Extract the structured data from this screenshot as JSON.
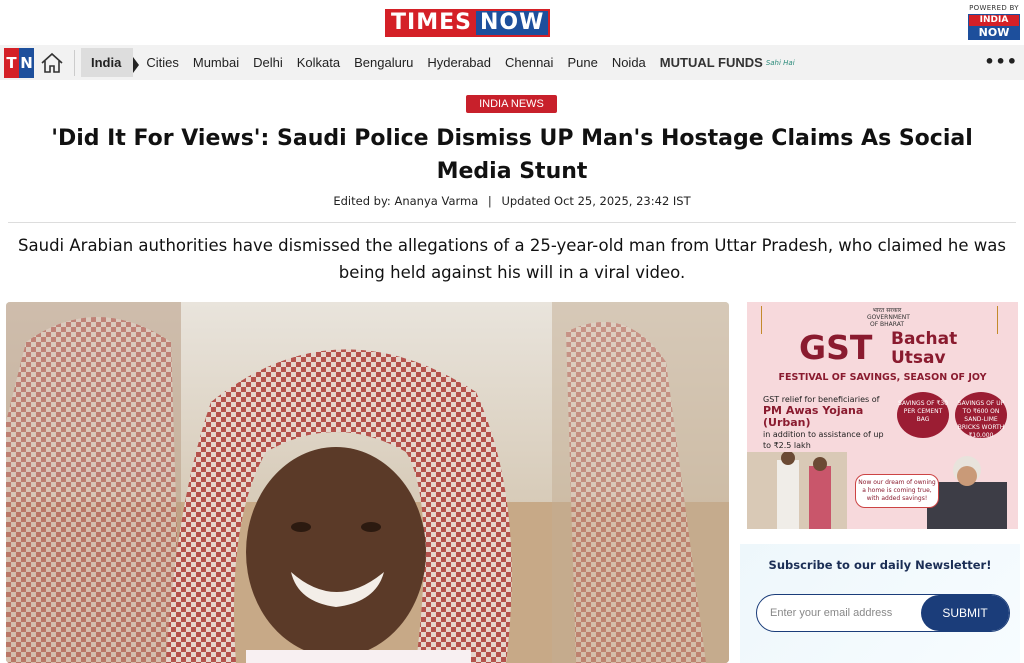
{
  "header": {
    "logo_left": "TIMES",
    "logo_right": "NOW",
    "powered_by": "POWERED BY",
    "partner_top": "INDIA",
    "partner_bottom": "NOW"
  },
  "nav": {
    "brand_t": "T",
    "brand_n": "N",
    "items": [
      {
        "label": "India",
        "active": true
      },
      {
        "label": "Cities"
      },
      {
        "label": "Mumbai"
      },
      {
        "label": "Delhi"
      },
      {
        "label": "Kolkata"
      },
      {
        "label": "Bengaluru"
      },
      {
        "label": "Hyderabad"
      },
      {
        "label": "Chennai"
      },
      {
        "label": "Pune"
      },
      {
        "label": "Noida"
      },
      {
        "label": "MUTUAL FUNDS"
      }
    ],
    "mf_tag": "Sahi Hai",
    "more": "•••"
  },
  "article": {
    "category": "INDIA NEWS",
    "headline": "'Did It For Views': Saudi Police Dismiss UP Man's Hostage Claims As Social Media Stunt",
    "edited_by_label": "Edited by:",
    "editor": "Ananya Varma",
    "separator": "|",
    "updated": "Updated Oct 25, 2025, 23:42 IST",
    "summary": "Saudi Arabian authorities have dismissed the allegations of a 25-year-old man from Uttar Pradesh, who claimed he was being held against his will in a viral video."
  },
  "ad": {
    "emblem_text": "भारत सरकार GOVERNMENT OF BHARAT",
    "gst": "GST",
    "bachat": "Bachat",
    "utsav": "Utsav",
    "festival": "FESTIVAL OF SAVINGS, SEASON OF JOY",
    "relief_line1": "GST relief",
    "relief_line2": "for beneficiaries of",
    "relief_scheme": "PM Awas Yojana (Urban)",
    "relief_line3": "in addition to assistance of up to ₹2.5 lakh",
    "coin1": "SAVINGS OF ₹30 PER CEMENT BAG",
    "coin2": "SAVINGS OF UP TO ₹600 ON SAND-LIME BRICKS WORTH ₹10,000",
    "quote": "Now our dream of owning a home is coming true, with added savings!"
  },
  "newsletter": {
    "title": "Subscribe to our daily Newsletter!",
    "placeholder": "Enter your email address",
    "submit": "SUBMIT"
  },
  "colors": {
    "brand_red": "#d42027",
    "brand_blue": "#1d4f9c",
    "category_red": "#c8202b",
    "submit_blue": "#1b3d7a"
  }
}
